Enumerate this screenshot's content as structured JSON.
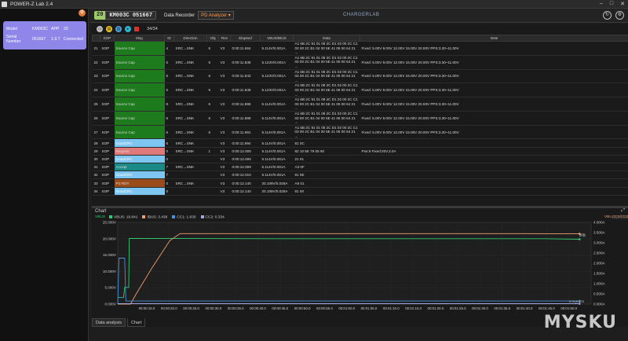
{
  "window": {
    "title": "POWER-Z Lab 2.4",
    "buttons": [
      "–",
      "□",
      "✕"
    ]
  },
  "sidebar": {
    "card": {
      "rows": [
        {
          "k": "Model",
          "v": "KM003C",
          "v2": "APP",
          "v3": "20"
        },
        {
          "k": "Serial Number",
          "v": "051667",
          "v2": "1.9.7",
          "v3": "Connected"
        }
      ]
    }
  },
  "topbar": {
    "device_num": "20",
    "device_name": "KM003C",
    "device_serial": "051667",
    "recorder_label": "Data Recorder",
    "analyzer_select": "PD Analyzer",
    "brand": "CHARGERLAB"
  },
  "toolbar": {
    "count": "34/34"
  },
  "table": {
    "columns": [
      "",
      "SOP",
      "Msg",
      "ID",
      "Direction",
      "Obj",
      "Rev",
      "Elapsed",
      "VBUS/IBUS",
      "Data",
      "Note"
    ],
    "rows": [
      {
        "n": "21",
        "sop": "SOP",
        "msg": "Source Cap",
        "type": "sc",
        "id": "4",
        "dir": "SRC→SNK",
        "obj": "6",
        "rev": "V3",
        "elapsed": "0:00:11.694",
        "vbus": "5.114V/0.001A",
        "data": "A1 6B 2C 91 01 08 2C D1 02 00 2C C1 03 00 2C B1 04 00 5E 41 06 00 64 21 ...",
        "note": "Fixed: 5.00V  9.00V  12.00V  15.00V  20.00V  PPS:3.30~11.00V",
        "tall": true
      },
      {
        "n": "22",
        "sop": "SOP",
        "msg": "Source Cap",
        "type": "sc",
        "id": "5",
        "dir": "SRC→SNK",
        "obj": "6",
        "rev": "V3",
        "elapsed": "0:00:11.838",
        "vbus": "5.123V/0.001A",
        "data": "A1 6B 2C 91 01 08 2C D1 02 00 2C C1 03 00 2C B1 04 00 5E 41 06 00 64 21 ...",
        "note": "Fixed: 5.00V  9.00V  12.00V  15.00V  20.00V  PPS:3.30~11.00V",
        "tall": true
      },
      {
        "n": "23",
        "sop": "SOP",
        "msg": "Source Cap",
        "type": "sc",
        "id": "5",
        "dir": "SRC→SNK",
        "obj": "6",
        "rev": "V3",
        "elapsed": "0:00:11.843",
        "vbus": "5.123V/0.001A",
        "data": "A1 6B 2C 91 01 08 2C D1 02 00 2C C1 03 00 2C B1 04 00 5E 41 06 00 64 21 ...",
        "note": "Fixed: 5.00V  9.00V  12.00V  15.00V  20.00V  PPS:3.30~11.00V",
        "tall": true
      },
      {
        "n": "24",
        "sop": "SOP",
        "msg": "Source Cap",
        "type": "sc",
        "id": "5",
        "dir": "SRC→SNK",
        "obj": "6",
        "rev": "V3",
        "elapsed": "0:00:11.849",
        "vbus": "5.123V/0.001A",
        "data": "A1 6B 2C 91 01 08 2C D1 02 00 2C C1 03 00 2C B1 04 00 5E 41 06 00 64 21 ...",
        "note": "Fixed: 5.00V  9.00V  12.00V  15.00V  20.00V  PPS:3.30~11.00V",
        "tall": true
      },
      {
        "n": "25",
        "sop": "SOP",
        "msg": "Source Cap",
        "type": "sc",
        "id": "6",
        "dir": "SRC→SNK",
        "obj": "6",
        "rev": "V3",
        "elapsed": "0:00:11.886",
        "vbus": "5.114V/0.001A",
        "data": "A1 6B 2C 91 01 08 2C D1 02 00 2C C1 03 00 2C B1 04 00 5E 41 06 00 64 21 ...",
        "note": "Fixed: 5.00V  9.00V  12.00V  15.00V  20.00V  PPS:3.30~11.00V",
        "tall": true
      },
      {
        "n": "26",
        "sop": "SOP",
        "msg": "Source Cap",
        "type": "sc",
        "id": "6",
        "dir": "SRC→SNK",
        "obj": "6",
        "rev": "V3",
        "elapsed": "0:00:11.889",
        "vbus": "5.114V/0.001A",
        "data": "A1 6B 2C 91 01 08 2C D1 02 00 2C C1 03 00 2C B1 04 00 5E 41 06 00 64 21 ...",
        "note": "Fixed: 5.00V  9.00V  12.00V  15.00V  20.00V  PPS:3.30~11.00V",
        "tall": true
      },
      {
        "n": "27",
        "sop": "SOP",
        "msg": "Source Cap",
        "type": "sc",
        "id": "6",
        "dir": "SRC→SNK",
        "obj": "6",
        "rev": "V3",
        "elapsed": "0:00:11.991",
        "vbus": "5.114V/0.001A",
        "data": "A1 6B 2C 91 01 08 2C D1 02 00 2C C1 03 00 2C B1 04 00 5E 41 06 00 64 21 ...",
        "note": "Fixed: 5.00V  9.00V  12.00V  15.00V  20.00V  PPS:3.30~11.00V",
        "tall": true
      },
      {
        "n": "28",
        "sop": "SOP",
        "msg": "GoodCRC",
        "type": "gc",
        "id": "6",
        "dir": "SRC→SNK",
        "obj": "",
        "rev": "V3",
        "elapsed": "0:00:11.994",
        "vbus": "5.114V/0.001A",
        "data": "81 0C",
        "note": "",
        "tall": false
      },
      {
        "n": "29",
        "sop": "SOP",
        "msg": "Request",
        "type": "rq",
        "id": "0",
        "dir": "SRC→SNK",
        "obj": "1",
        "rev": "V3",
        "elapsed": "0:00:12.005",
        "vbus": "5.114V/0.001A",
        "data": "82 10 5E 79 05 50",
        "note": "Pos:5 Fixed:20V,3.0A",
        "tall": false
      },
      {
        "n": "30",
        "sop": "SOP",
        "msg": "GoodCRC",
        "type": "gc",
        "id": "0",
        "dir": "",
        "obj": "",
        "rev": "V3",
        "elapsed": "0:00:12.006",
        "vbus": "5.114V/0.001A",
        "data": "21 01",
        "note": "",
        "tall": false
      },
      {
        "n": "31",
        "sop": "SOP",
        "msg": "Accept",
        "type": "ac",
        "id": "7",
        "dir": "SRC→SNK",
        "obj": "",
        "rev": "V3",
        "elapsed": "0:00:12.009",
        "vbus": "5.114V/0.001A",
        "data": "A3 0F",
        "note": "",
        "tall": false
      },
      {
        "n": "32",
        "sop": "SOP",
        "msg": "GoodCRC",
        "type": "gc",
        "id": "7",
        "dir": "",
        "obj": "",
        "rev": "V3",
        "elapsed": "0:00:12.010",
        "vbus": "5.114V/0.001A",
        "data": "81 0E",
        "note": "",
        "tall": false
      },
      {
        "n": "33",
        "sop": "SOP",
        "msg": "PS RDY",
        "type": "ps",
        "id": "0",
        "dir": "SRC→SNK",
        "obj": "",
        "rev": "V3",
        "elapsed": "0:00:12.140",
        "vbus": "20.109V/0.028A",
        "data": "A6 01",
        "note": "",
        "tall": false,
        "green": true
      },
      {
        "n": "34",
        "sop": "SOP",
        "msg": "GoodCRC",
        "type": "gc",
        "id": "0",
        "dir": "",
        "obj": "",
        "rev": "V3",
        "elapsed": "0:00:12.140",
        "vbus": "20.109V/0.028A",
        "data": "81 00",
        "note": "",
        "tall": false,
        "green": true
      }
    ]
  },
  "chart": {
    "title": "Chart",
    "legend": [
      {
        "label": "VBUS: 19.841",
        "color": "#2ecc71"
      },
      {
        "label": "IBUS: 3.438",
        "color": "#f0a070"
      },
      {
        "label": "CC1: 1.830",
        "color": "#4a90e2"
      },
      {
        "label": "CC2: 0.334",
        "color": "#9fa8da"
      }
    ],
    "left_axis_tag": "VBUS",
    "right_axis_tag": "VBUS",
    "right_axis_tag2": "CC1/CC2",
    "marker_label": "20|1",
    "marker_label2": "0.01|0.423"
  },
  "chart_data": {
    "type": "line",
    "x_ticks": [
      "00:00:15.0",
      "00:00:20.0",
      "00:00:25.0",
      "00:00:30.0",
      "00:00:35.0",
      "00:00:40.0",
      "00:00:45.0",
      "00:00:50.0",
      "00:00:55.0",
      "00:01:00.0",
      "00:01:05.0",
      "00:01:10.0",
      "00:01:15.0",
      "00:01:20.0",
      "00:01:25.0",
      "00:01:30.0",
      "00:01:35.0",
      "00:01:40.0",
      "00:01:45.0",
      "00:01:50.0"
    ],
    "xlim": [
      11,
      52
    ],
    "y_left_ticks": [
      "25.000V",
      "20.000V",
      "15.000V",
      "10.000V",
      "5.000V",
      "0.000V"
    ],
    "ylim_left": [
      0,
      25
    ],
    "y_right_ticks": [
      "4.000A",
      "3.500A",
      "3.000A",
      "2.500A",
      "2.000A",
      "1.500A",
      "1.000A",
      "0.500A",
      "0.000A"
    ],
    "ylim_right": [
      0,
      4
    ],
    "series": [
      {
        "name": "VBUS",
        "color": "#2ecc71",
        "axis": "left",
        "points": [
          [
            11.0,
            2.0
          ],
          [
            11.5,
            2.0
          ],
          [
            11.6,
            5.1
          ],
          [
            11.95,
            5.1
          ],
          [
            12.0,
            20.1
          ],
          [
            18.0,
            20.05
          ],
          [
            24.0,
            20.0
          ],
          [
            30.0,
            20.0
          ],
          [
            36.0,
            20.0
          ],
          [
            42.0,
            20.0
          ],
          [
            48.0,
            20.0
          ],
          [
            51.0,
            19.84
          ]
        ]
      },
      {
        "name": "IBUS",
        "color": "#f0a070",
        "axis": "right",
        "points": [
          [
            11.0,
            0.0
          ],
          [
            12.1,
            0.0
          ],
          [
            12.6,
            0.5
          ],
          [
            14.0,
            1.8
          ],
          [
            15.5,
            3.1
          ],
          [
            16.4,
            3.45
          ],
          [
            24.0,
            3.45
          ],
          [
            32.0,
            3.45
          ],
          [
            40.0,
            3.45
          ],
          [
            46.0,
            3.45
          ],
          [
            51.0,
            3.44
          ]
        ]
      },
      {
        "name": "CC1",
        "color": "#4a90e2",
        "axis": "right",
        "points": [
          [
            11.0,
            0.0
          ],
          [
            11.1,
            2.25
          ],
          [
            11.6,
            2.25
          ],
          [
            11.7,
            0.15
          ],
          [
            51.0,
            0.15
          ]
        ]
      },
      {
        "name": "CC2",
        "color": "#9fa8da",
        "axis": "right",
        "points": [
          [
            11.0,
            0.02
          ],
          [
            51.0,
            0.02
          ]
        ]
      }
    ]
  },
  "bottom_tabs": [
    "Data analysis",
    "Chart"
  ],
  "watermark": "MYSKU"
}
